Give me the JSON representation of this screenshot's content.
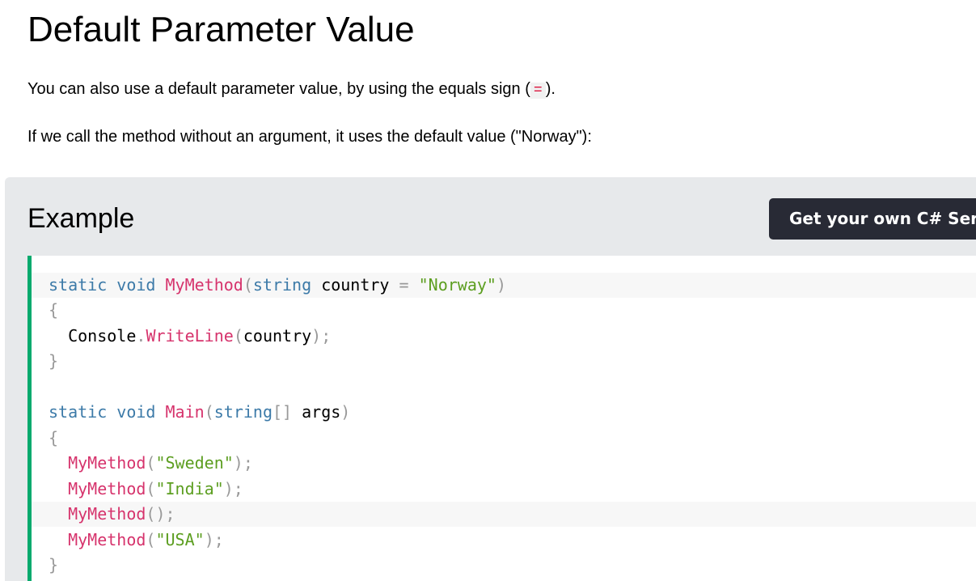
{
  "page": {
    "title": "Default Parameter Value",
    "intro_before": "You can also use a default parameter value, by using the equals sign (",
    "intro_code": "=",
    "intro_after": ").",
    "second_paragraph": "If we call the method without an argument, it uses the default value (\"Norway\"):"
  },
  "example": {
    "heading": "Example",
    "server_button": "Get your own C# Server",
    "colors": {
      "keyword": "#3c7aa8",
      "function": "#d6336c",
      "string": "#5c9e20",
      "punctuation": "#999999",
      "accent_border": "#04aa6d",
      "button_bg": "#282a35"
    },
    "code": {
      "l1": {
        "kw1": "static",
        "kw2": "void",
        "fn": "MyMethod",
        "p1": "(",
        "kw3": "string",
        "id": "country",
        "eq": "=",
        "str": "\"Norway\"",
        "p2": ")"
      },
      "l2": {
        "p": "{"
      },
      "l3": {
        "id": "Console",
        "dot": ".",
        "fn": "WriteLine",
        "p1": "(",
        "arg": "country",
        "p2": ");"
      },
      "l4": {
        "p": "}"
      },
      "l6": {
        "kw1": "static",
        "kw2": "void",
        "fn": "Main",
        "p1": "(",
        "kw3": "string",
        "br": "[]",
        "id": "args",
        "p2": ")"
      },
      "l7": {
        "p": "{"
      },
      "l8": {
        "fn": "MyMethod",
        "p1": "(",
        "str": "\"Sweden\"",
        "p2": ");"
      },
      "l9": {
        "fn": "MyMethod",
        "p1": "(",
        "str": "\"India\"",
        "p2": ");"
      },
      "l10": {
        "fn": "MyMethod",
        "p": "();"
      },
      "l11": {
        "fn": "MyMethod",
        "p1": "(",
        "str": "\"USA\"",
        "p2": ");"
      },
      "l12": {
        "p": "}"
      }
    }
  }
}
